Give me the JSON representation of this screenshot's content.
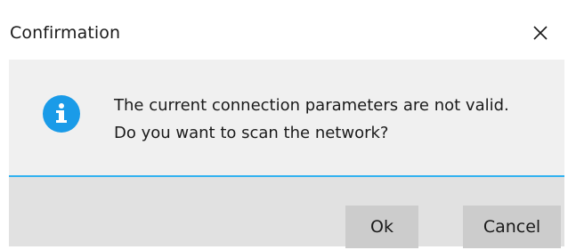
{
  "dialog": {
    "title": "Confirmation",
    "close_icon": "close-icon",
    "message_lines": [
      "The current connection parameters are not valid.",
      "Do you want to scan the network?"
    ],
    "info_icon": "info-icon",
    "buttons": {
      "ok_label": "Ok",
      "cancel_label": "Cancel"
    }
  },
  "colors": {
    "info_icon_bg": "#1a9be8",
    "separator": "#32b2f0",
    "content_bg": "#f0f0f0",
    "footer_bg": "#e1e1e1",
    "button_bg": "#cccccc"
  }
}
